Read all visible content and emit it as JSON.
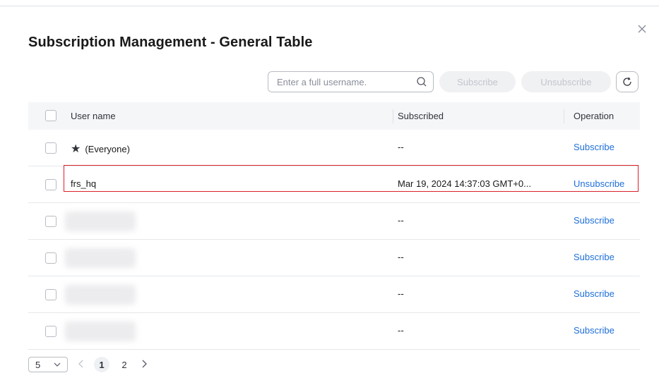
{
  "dialog": {
    "title": "Subscription Management - General Table"
  },
  "toolbar": {
    "search_placeholder": "Enter a full username.",
    "subscribe_label": "Subscribe",
    "unsubscribe_label": "Unsubscribe"
  },
  "table": {
    "columns": [
      "User name",
      "Subscribed",
      "Operation"
    ],
    "rows": [
      {
        "user": "(Everyone)",
        "subscribed": "--",
        "operation": "Subscribe"
      },
      {
        "user": "frs_hq",
        "subscribed": "Mar 19, 2024 14:37:03 GMT+0...",
        "operation": "Unsubscribe"
      },
      {
        "user": "",
        "subscribed": "--",
        "operation": "Subscribe"
      },
      {
        "user": "",
        "subscribed": "--",
        "operation": "Subscribe"
      },
      {
        "user": "",
        "subscribed": "--",
        "operation": "Subscribe"
      },
      {
        "user": "",
        "subscribed": "--",
        "operation": "Subscribe"
      }
    ]
  },
  "pagination": {
    "page_size": "5",
    "pages": [
      "1",
      "2"
    ],
    "current_page": "1"
  },
  "colors": {
    "link": "#1e6fd9",
    "highlight": "#d9222a",
    "header_bg": "#f5f6f8"
  }
}
